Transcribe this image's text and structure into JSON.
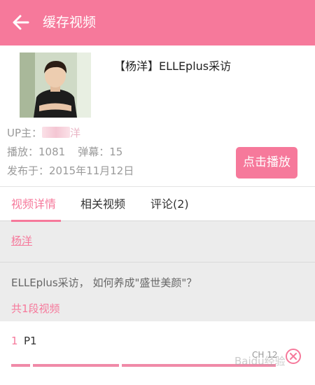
{
  "header": {
    "title": "缓存视频",
    "back_icon": "arrow-left-icon"
  },
  "video": {
    "title": "【杨洋】ELLEplus采访",
    "up_label": "UP主：",
    "up_name_visible": "洋",
    "plays": "播放：1081",
    "danmaku": "弹幕：15",
    "published": "发布于：2015年11月12日",
    "play_button": "点击播放"
  },
  "tabs": [
    {
      "label": "视频详情",
      "active": true
    },
    {
      "label": "相关视频",
      "active": false
    },
    {
      "label": "评论(2)",
      "active": false
    }
  ],
  "details": {
    "uploader_link": "杨洋",
    "description": "ELLEplus采访， 如何养成\"盛世美颜\"？",
    "segments_title": "共1段视频"
  },
  "parts": [
    {
      "index": "1",
      "name": "P1",
      "status": "CH 12",
      "progress": 1.0
    }
  ],
  "watermark": "Baidu经验",
  "colors": {
    "accent": "#f6799b",
    "background": "#ececec"
  }
}
